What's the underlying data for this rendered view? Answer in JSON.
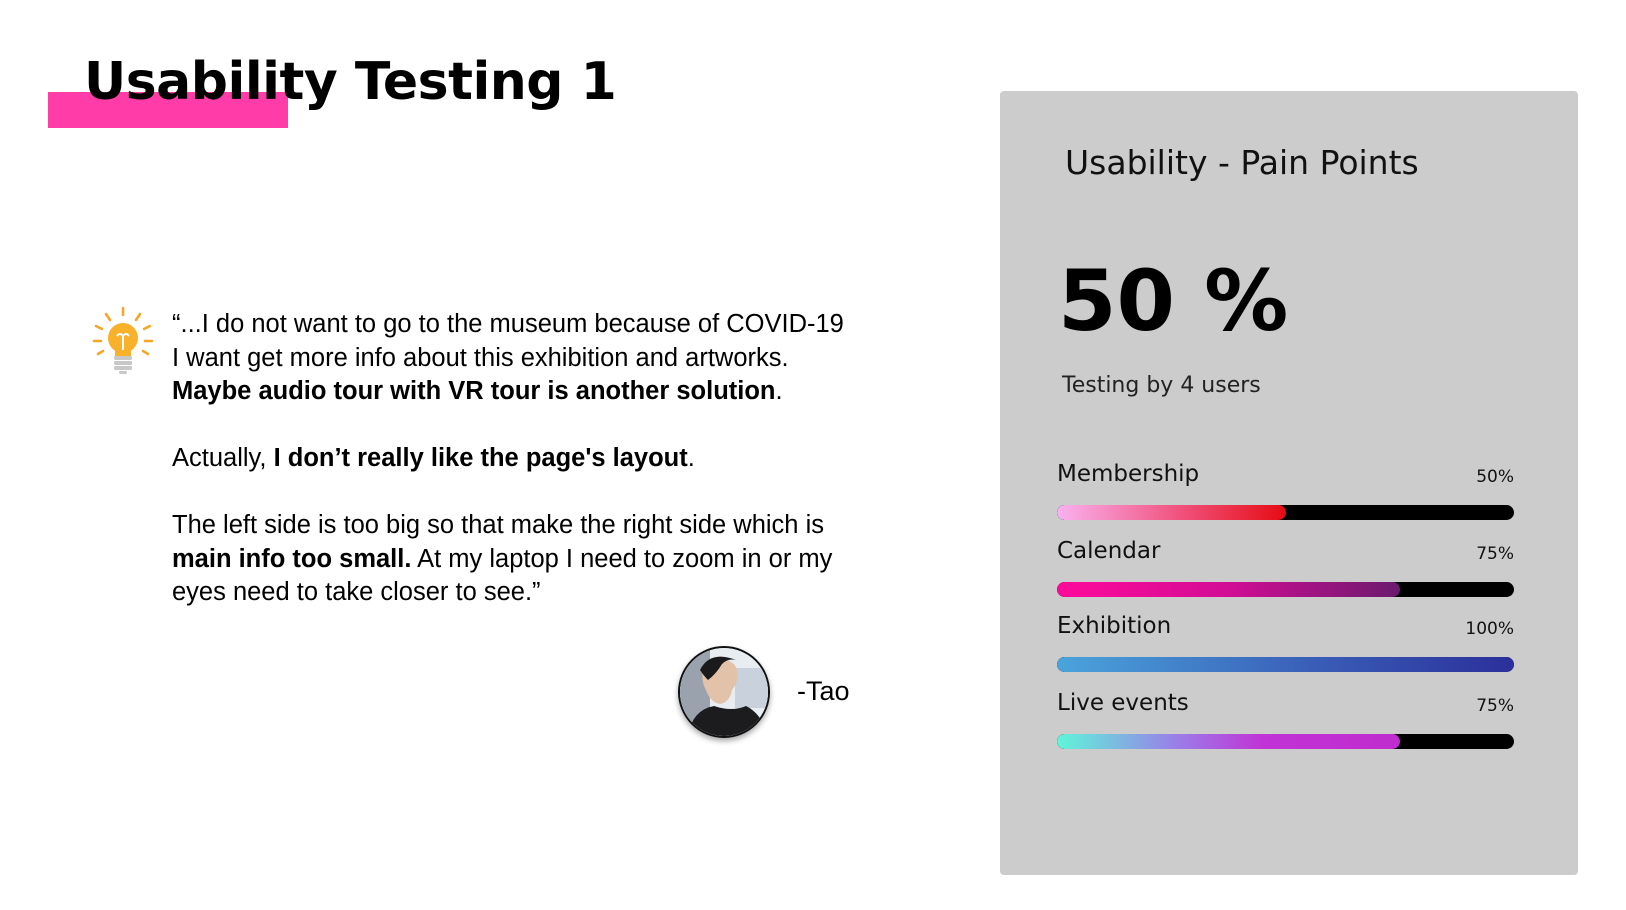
{
  "title": "Usability Testing 1",
  "colors": {
    "accent": "#ff3ca8",
    "card_background": "#cccccc"
  },
  "quote": {
    "icon": "lightbulb-icon",
    "line1": "“...I do not want to go to the museum because of COVID-19",
    "line2": "I want get more info about this exhibition and artworks.",
    "line3_bold": "Maybe audio tour with VR tour is another solution",
    "line3_end": ".",
    "p2_start": "Actually, ",
    "p2_bold": "I don’t really like the page's layout",
    "p2_end": ".",
    "p3_start": "The left side is too big so that make the right side which is",
    "p3_bold": "main info too small.",
    "p3_mid": " At my laptop I need to zoom in or my",
    "p3_end": "eyes need to take closer to see.”",
    "author": "-Tao"
  },
  "card": {
    "title": "Usability - Pain Points",
    "big_stat": "50 %",
    "caption": "Testing by 4 users",
    "items": [
      {
        "label": "Membership",
        "value_text": "50%",
        "value": 0.5
      },
      {
        "label": "Calendar",
        "value_text": "75%",
        "value": 0.75
      },
      {
        "label": "Exhibition",
        "value_text": "100%",
        "value": 1.0
      },
      {
        "label": "Live events",
        "value_text": "75%",
        "value": 0.75
      }
    ]
  }
}
